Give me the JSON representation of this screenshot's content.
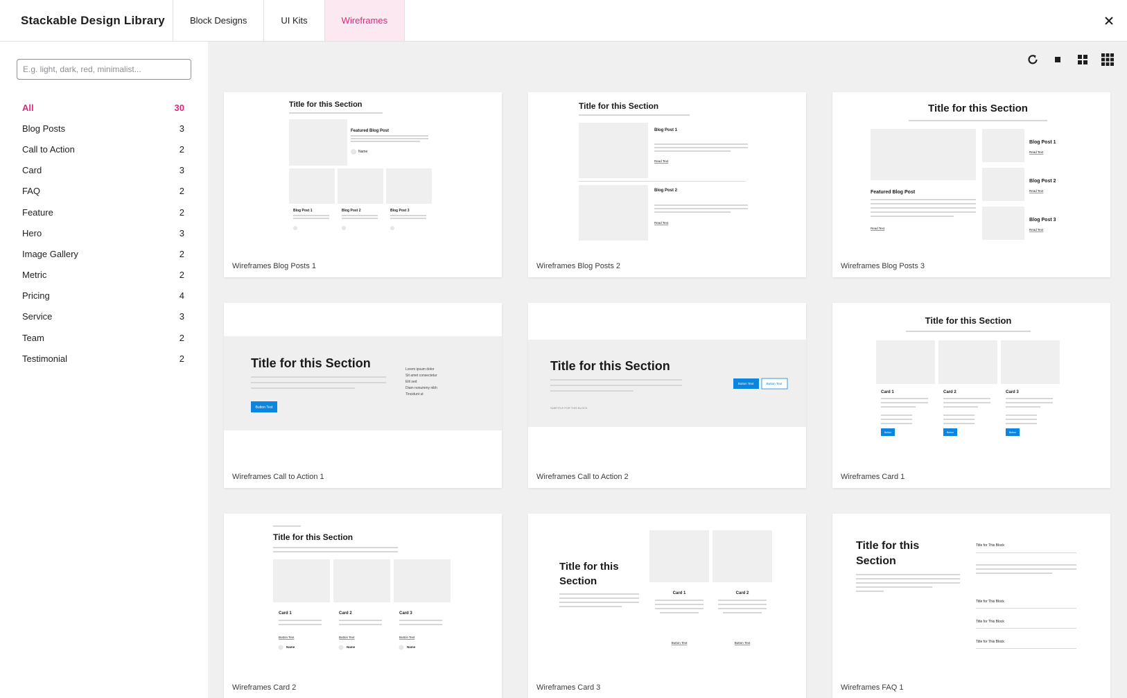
{
  "header": {
    "title": "Stackable Design Library",
    "tabs": [
      {
        "label": "Block Designs",
        "active": false
      },
      {
        "label": "UI Kits",
        "active": false
      },
      {
        "label": "Wireframes",
        "active": true
      }
    ],
    "close_icon": "close-icon"
  },
  "sidebar": {
    "search_placeholder": "E.g. light, dark, red, minimalist...",
    "categories": [
      {
        "label": "All",
        "count": "30",
        "active": true
      },
      {
        "label": "Blog Posts",
        "count": "3"
      },
      {
        "label": "Call to Action",
        "count": "2"
      },
      {
        "label": "Card",
        "count": "3"
      },
      {
        "label": "FAQ",
        "count": "2"
      },
      {
        "label": "Feature",
        "count": "2"
      },
      {
        "label": "Hero",
        "count": "3"
      },
      {
        "label": "Image Gallery",
        "count": "2"
      },
      {
        "label": "Metric",
        "count": "2"
      },
      {
        "label": "Pricing",
        "count": "4"
      },
      {
        "label": "Service",
        "count": "3"
      },
      {
        "label": "Team",
        "count": "2"
      },
      {
        "label": "Testimonial",
        "count": "2"
      }
    ]
  },
  "toolbar": {
    "icons": [
      "refresh-icon",
      "single-column-icon",
      "two-column-grid-icon",
      "three-column-grid-icon"
    ]
  },
  "colors": {
    "accent": "#e0247c",
    "accent_bg": "#fce8f1",
    "button_blue": "#0a85e0",
    "main_bg": "#f0f0f0"
  },
  "cards": [
    {
      "label": "Wireframes Blog Posts 1",
      "section_title": "Title for this Section",
      "featured": "Featured Blog Post",
      "posts": [
        "Blog Post 1",
        "Blog Post 2",
        "Blog Post 3"
      ],
      "author": "Name"
    },
    {
      "label": "Wireframes Blog Posts 2",
      "section_title": "Title for this Section",
      "posts": [
        "Blog Post 1",
        "Blog Post 2"
      ],
      "link": "Read Text"
    },
    {
      "label": "Wireframes Blog Posts 3",
      "section_title": "Title for this Section",
      "featured": "Featured Blog Post",
      "posts": [
        "Blog Post 1",
        "Blog Post 2",
        "Blog Post 3"
      ],
      "link": "Read Text"
    },
    {
      "label": "Wireframes Call to Action 1",
      "section_title": "Title for this Section",
      "button": "Button Text",
      "list": [
        "Lorem ipsum dolor",
        "Sit amet consectetur",
        "Elit sed",
        "Diam nonummy nibh",
        "Tincidunt ut"
      ]
    },
    {
      "label": "Wireframes Call to Action 2",
      "section_title": "Title for this Section",
      "buttons": [
        "Button Text",
        "Button Text"
      ],
      "subtitle": "SUBTITLE FOR THIS BLOCK"
    },
    {
      "label": "Wireframes Card 1",
      "section_title": "Title for this Section",
      "cards": [
        "Card 1",
        "Card 2",
        "Card 3"
      ],
      "button": "Button"
    },
    {
      "label": "Wireframes Card 2",
      "section_title": "Title for this Section",
      "cards": [
        "Card 1",
        "Card 2",
        "Card 3"
      ],
      "link": "Button Text",
      "author": "Name"
    },
    {
      "label": "Wireframes Card 3",
      "section_title_lines": [
        "Title for this",
        "Section"
      ],
      "cards": [
        "Card 1",
        "Card 2"
      ],
      "link": "Button Text"
    },
    {
      "label": "Wireframes FAQ 1",
      "section_title_lines": [
        "Title for this",
        "Section"
      ],
      "questions": [
        "Title for This Block",
        "Title for This Block",
        "Title for This Block",
        "Title for This Block"
      ]
    }
  ]
}
